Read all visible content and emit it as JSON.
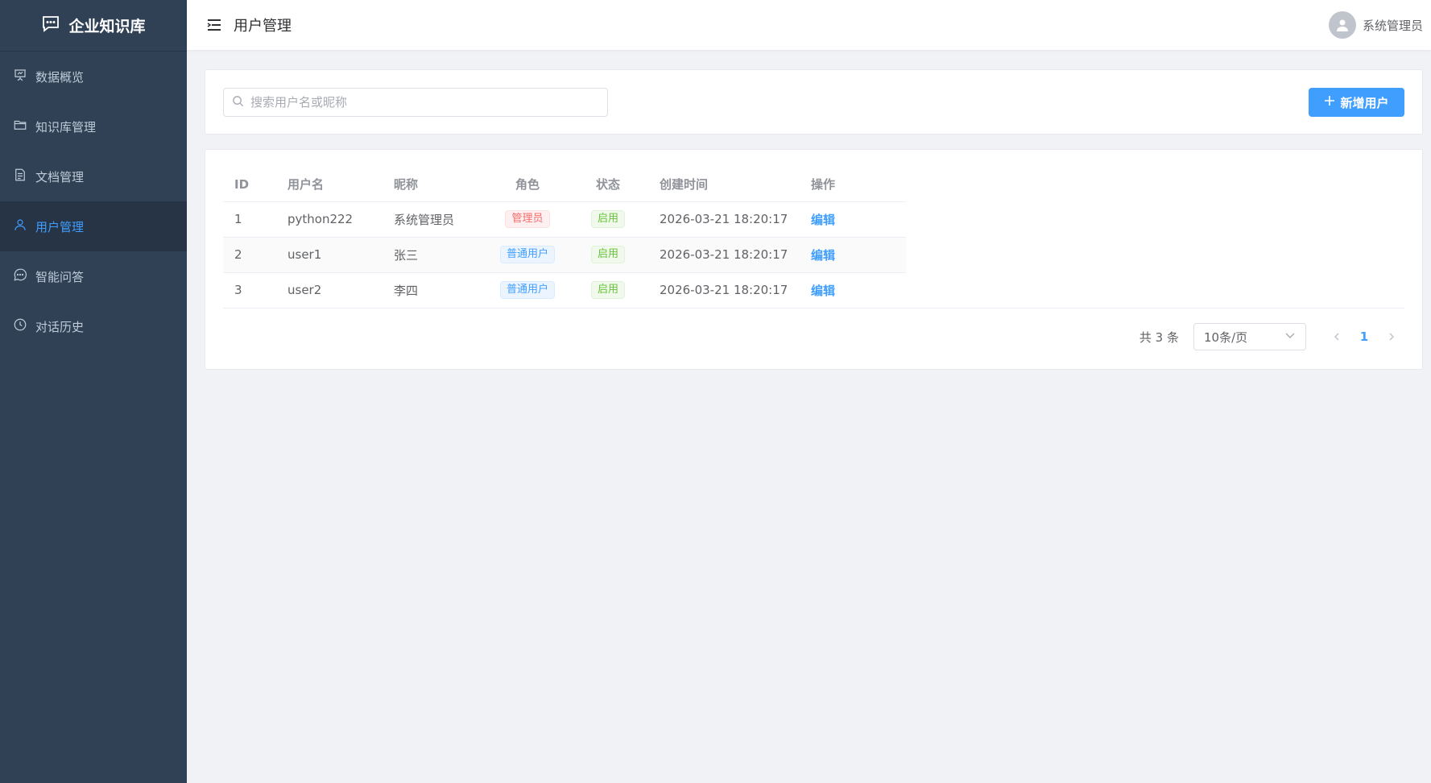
{
  "sidebar": {
    "brand": "企业知识库",
    "items": [
      {
        "label": "数据概览",
        "icon": "presentation-icon"
      },
      {
        "label": "知识库管理",
        "icon": "folder-icon"
      },
      {
        "label": "文档管理",
        "icon": "document-icon"
      },
      {
        "label": "用户管理",
        "icon": "user-icon",
        "active": true
      },
      {
        "label": "智能问答",
        "icon": "chat-icon"
      },
      {
        "label": "对话历史",
        "icon": "clock-icon"
      }
    ]
  },
  "header": {
    "title": "用户管理",
    "username": "系统管理员"
  },
  "search": {
    "placeholder": "搜索用户名或昵称",
    "value": ""
  },
  "toolbar": {
    "add_label": "新增用户"
  },
  "table": {
    "columns": [
      "ID",
      "用户名",
      "昵称",
      "角色",
      "状态",
      "创建时间",
      "操作"
    ],
    "rows": [
      {
        "id": "1",
        "username": "python222",
        "nickname": "系统管理员",
        "role": "管理员",
        "role_type": "danger",
        "status": "启用",
        "created": "2026-03-21 18:20:17",
        "action": "编辑"
      },
      {
        "id": "2",
        "username": "user1",
        "nickname": "张三",
        "role": "普通用户",
        "role_type": "info",
        "status": "启用",
        "created": "2026-03-21 18:20:17",
        "action": "编辑"
      },
      {
        "id": "3",
        "username": "user2",
        "nickname": "李四",
        "role": "普通用户",
        "role_type": "info",
        "status": "启用",
        "created": "2026-03-21 18:20:17",
        "action": "编辑"
      }
    ]
  },
  "pagination": {
    "total_text": "共 3 条",
    "page_size": "10条/页",
    "current_page": "1"
  },
  "colors": {
    "sidebar_bg": "#304156",
    "accent": "#409eff",
    "danger": "#f56c6c",
    "success": "#67c23a"
  }
}
